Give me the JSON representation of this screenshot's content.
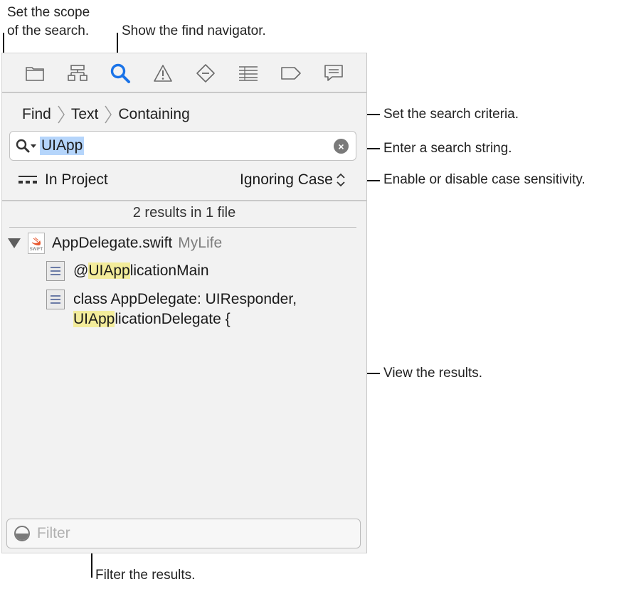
{
  "callouts": {
    "scope_line1": "Set the scope",
    "scope_line2": "of the search.",
    "show_find": "Show the find navigator.",
    "criteria": "Set the search criteria.",
    "enter_string": "Enter a search string.",
    "case_sensitivity": "Enable or disable case sensitivity.",
    "view_results": "View the results.",
    "filter_results": "Filter the results."
  },
  "toolbar": {
    "icons": [
      "folder-icon",
      "hierarchy-icon",
      "search-icon",
      "warning-icon",
      "breakpoint-icon",
      "report-list-icon",
      "tag-icon",
      "comment-icon"
    ],
    "active": "search-icon",
    "accent": "#1a73e8"
  },
  "breadcrumb": {
    "items": [
      "Find",
      "Text",
      "Containing"
    ]
  },
  "search": {
    "value": "UIApp"
  },
  "scope": {
    "label": "In Project"
  },
  "case": {
    "label": "Ignoring Case"
  },
  "results": {
    "summary": "2 results in 1 file",
    "file": {
      "name": "AppDelegate.swift",
      "project": "MyLife",
      "icon_label": "SWIFT"
    },
    "matches": [
      {
        "prefix": "@",
        "highlight": "UIApp",
        "rest": "licationMain"
      },
      {
        "line1": "class AppDelegate: UIResponder,",
        "highlight": "UIApp",
        "rest": "licationDelegate {"
      }
    ]
  },
  "filter": {
    "placeholder": "Filter"
  }
}
